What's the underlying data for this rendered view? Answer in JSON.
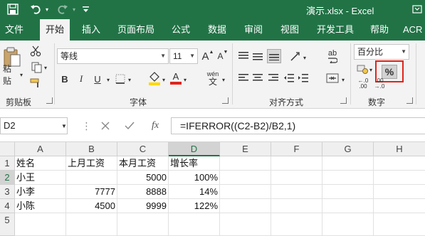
{
  "window": {
    "title": "演示.xlsx  -  Excel"
  },
  "tabs": [
    "文件",
    "开始",
    "插入",
    "页面布局",
    "公式",
    "数据",
    "审阅",
    "视图",
    "开发工具",
    "帮助",
    "ACR"
  ],
  "active_tab": "开始",
  "ribbon": {
    "clipboard": {
      "paste_label": "粘贴",
      "group_label": "剪贴板"
    },
    "font": {
      "font_name": "等线",
      "font_size": "11",
      "group_label": "字体",
      "bold": "B",
      "italic": "I",
      "underline": "U",
      "grow": "A",
      "shrink": "A",
      "wen_top": "wén",
      "wen_bottom": "文"
    },
    "alignment": {
      "group_label": "对齐方式",
      "ab_label": "ab"
    },
    "number": {
      "format_value": "百分比",
      "percent_label": "%",
      "group_label": "数字",
      "highlight_color": "#e0241b"
    }
  },
  "formula_bar": {
    "name_box": "D2",
    "fx": "fx",
    "formula": "=IFERROR((C2-B2)/B2,1)"
  },
  "sheet": {
    "columns": [
      "A",
      "B",
      "C",
      "D",
      "E",
      "F",
      "G",
      "H"
    ],
    "rows": [
      "1",
      "2",
      "3",
      "4",
      "5"
    ],
    "cells": [
      [
        "姓名",
        "上月工资",
        "本月工资",
        "增长率",
        "",
        "",
        "",
        ""
      ],
      [
        "小王",
        "",
        "5000",
        "100%",
        "",
        "",
        "",
        ""
      ],
      [
        "小李",
        "7777",
        "8888",
        "14%",
        "",
        "",
        "",
        ""
      ],
      [
        "小陈",
        "4500",
        "9999",
        "122%",
        "",
        "",
        "",
        ""
      ],
      [
        "",
        "",
        "",
        "",
        "",
        "",
        "",
        ""
      ]
    ]
  },
  "colors": {
    "excel_green": "#217346",
    "ribbon_bg": "#f3f3f3",
    "fill_yellow": "#ffd800",
    "font_red": "#e0241b"
  }
}
